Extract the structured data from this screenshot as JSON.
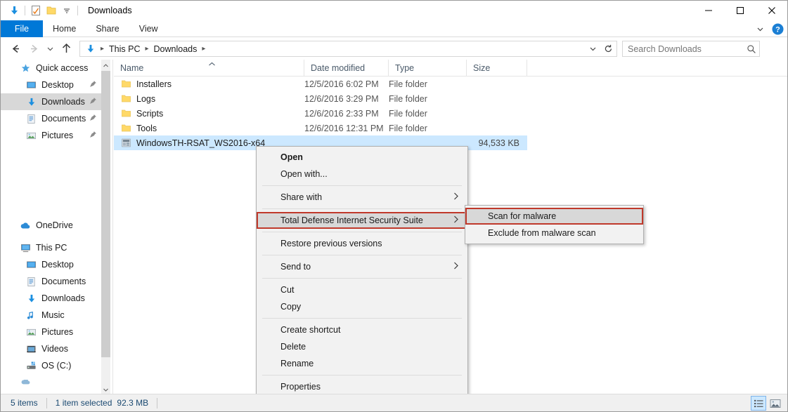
{
  "window": {
    "title": "Downloads",
    "quick_access_icons": [
      "download-arrow-icon",
      "properties-icon",
      "new-folder-icon",
      "customize-qat-chevron-icon"
    ],
    "controls": {
      "minimize": "minimize-icon",
      "maximize": "maximize-icon",
      "close": "close-icon"
    }
  },
  "ribbon": {
    "tabs": [
      {
        "label": "File",
        "active": true
      },
      {
        "label": "Home",
        "active": false
      },
      {
        "label": "Share",
        "active": false
      },
      {
        "label": "View",
        "active": false
      }
    ],
    "expand_icon": "chevron-down-icon",
    "help_icon": "help-icon"
  },
  "nav": {
    "back_icon": "back-arrow-icon",
    "forward_icon": "forward-arrow-icon",
    "recent_icon": "chevron-down-icon",
    "up_icon": "up-arrow-icon",
    "breadcrumb": [
      {
        "label": "",
        "icon": "downloads-folder-icon"
      },
      {
        "label": "This PC"
      },
      {
        "label": "Downloads"
      }
    ],
    "dropdown_icon": "chevron-down-icon",
    "refresh_icon": "refresh-icon"
  },
  "search": {
    "placeholder": "Search Downloads",
    "icon": "search-icon"
  },
  "sidebar": {
    "groups": [
      {
        "header": {
          "label": "Quick access",
          "icon": "star-icon"
        },
        "items": [
          {
            "label": "Desktop",
            "icon": "desktop-icon",
            "pinned": true,
            "selected": false
          },
          {
            "label": "Downloads",
            "icon": "downloads-icon",
            "pinned": true,
            "selected": true
          },
          {
            "label": "Documents",
            "icon": "documents-icon",
            "pinned": true,
            "selected": false
          },
          {
            "label": "Pictures",
            "icon": "pictures-icon",
            "pinned": true,
            "selected": false
          }
        ]
      },
      {
        "header": {
          "label": "OneDrive",
          "icon": "onedrive-icon"
        },
        "items": []
      },
      {
        "header": {
          "label": "This PC",
          "icon": "thispc-icon"
        },
        "items": [
          {
            "label": "Desktop",
            "icon": "desktop-icon",
            "pinned": false,
            "selected": false
          },
          {
            "label": "Documents",
            "icon": "documents-icon",
            "pinned": false,
            "selected": false
          },
          {
            "label": "Downloads",
            "icon": "downloads-icon",
            "pinned": false,
            "selected": false
          },
          {
            "label": "Music",
            "icon": "music-icon",
            "pinned": false,
            "selected": false
          },
          {
            "label": "Pictures",
            "icon": "pictures-icon",
            "pinned": false,
            "selected": false
          },
          {
            "label": "Videos",
            "icon": "videos-icon",
            "pinned": false,
            "selected": false
          },
          {
            "label": "OS (C:)",
            "icon": "drive-icon",
            "pinned": false,
            "selected": false
          }
        ]
      }
    ],
    "scrollbar": {
      "up_icon": "scroll-up-icon",
      "down_icon": "scroll-down-icon"
    }
  },
  "filelist": {
    "columns": [
      {
        "label": "Name",
        "sorted": true,
        "sort_icon": "sort-ascending-caret"
      },
      {
        "label": "Date modified",
        "sorted": false
      },
      {
        "label": "Type",
        "sorted": false
      },
      {
        "label": "Size",
        "sorted": false
      }
    ],
    "rows": [
      {
        "name": "Installers",
        "date": "12/5/2016 6:02 PM",
        "type": "File folder",
        "size": "",
        "icon": "folder-icon",
        "selected": false
      },
      {
        "name": "Logs",
        "date": "12/6/2016 3:29 PM",
        "type": "File folder",
        "size": "",
        "icon": "folder-icon",
        "selected": false
      },
      {
        "name": "Scripts",
        "date": "12/6/2016 2:33 PM",
        "type": "File folder",
        "size": "",
        "icon": "folder-icon",
        "selected": false
      },
      {
        "name": "Tools",
        "date": "12/6/2016 12:31 PM",
        "type": "File folder",
        "size": "",
        "icon": "folder-icon",
        "selected": false
      },
      {
        "name": "WindowsTH-RSAT_WS2016-x64",
        "date": "",
        "type": "",
        "size": "94,533 KB",
        "icon": "msu-package-icon",
        "selected": true
      }
    ]
  },
  "context_menu": {
    "items": [
      {
        "label": "Open",
        "bold": true,
        "submenu": false,
        "highlighted": false,
        "outlined": false
      },
      {
        "label": "Open with...",
        "bold": false,
        "submenu": false,
        "highlighted": false,
        "outlined": false
      },
      {
        "separator": true
      },
      {
        "label": "Share with",
        "bold": false,
        "submenu": true,
        "highlighted": false,
        "outlined": false
      },
      {
        "separator": true
      },
      {
        "label": "Total Defense Internet Security Suite",
        "bold": false,
        "submenu": true,
        "highlighted": true,
        "outlined": true
      },
      {
        "separator": true
      },
      {
        "label": "Restore previous versions",
        "bold": false,
        "submenu": false,
        "highlighted": false,
        "outlined": false
      },
      {
        "separator": true
      },
      {
        "label": "Send to",
        "bold": false,
        "submenu": true,
        "highlighted": false,
        "outlined": false
      },
      {
        "separator": true
      },
      {
        "label": "Cut",
        "bold": false,
        "submenu": false,
        "highlighted": false,
        "outlined": false
      },
      {
        "label": "Copy",
        "bold": false,
        "submenu": false,
        "highlighted": false,
        "outlined": false
      },
      {
        "separator": true
      },
      {
        "label": "Create shortcut",
        "bold": false,
        "submenu": false,
        "highlighted": false,
        "outlined": false
      },
      {
        "label": "Delete",
        "bold": false,
        "submenu": false,
        "highlighted": false,
        "outlined": false
      },
      {
        "label": "Rename",
        "bold": false,
        "submenu": false,
        "highlighted": false,
        "outlined": false
      },
      {
        "separator": true
      },
      {
        "label": "Properties",
        "bold": false,
        "submenu": false,
        "highlighted": false,
        "outlined": false
      }
    ],
    "submenu_arrow_icon": "chevron-right-icon"
  },
  "submenu": {
    "items": [
      {
        "label": "Scan for malware",
        "highlighted": true,
        "outlined": true
      },
      {
        "label": "Exclude from malware scan",
        "highlighted": false,
        "outlined": false
      }
    ]
  },
  "statusbar": {
    "item_count": "5 items",
    "selection": "1 item selected",
    "selection_size": "92.3 MB",
    "views": [
      {
        "name": "details-view-button",
        "active": true
      },
      {
        "name": "large-icons-view-button",
        "active": false
      }
    ]
  },
  "colors": {
    "accent": "#0078d7",
    "selection": "#cce8ff",
    "highlight_outline": "#c0392b",
    "menu_bg": "#f2f2f2",
    "status_text": "#1a4971"
  }
}
